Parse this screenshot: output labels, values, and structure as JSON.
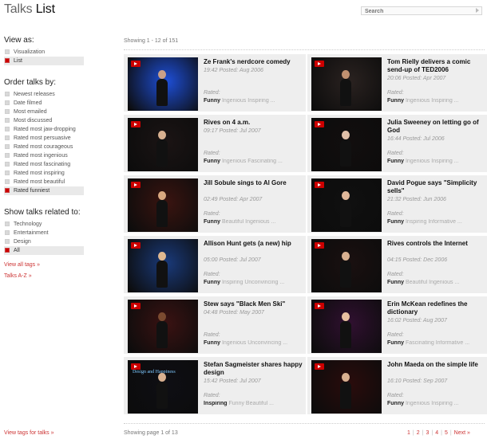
{
  "header": {
    "title_a": "Talks",
    "title_b": "List",
    "search_placeholder": "Search"
  },
  "sidebar": {
    "view_as": {
      "heading": "View as:",
      "items": [
        {
          "label": "Visualization",
          "selected": false
        },
        {
          "label": "List",
          "selected": true
        }
      ]
    },
    "order": {
      "heading": "Order talks by:",
      "items": [
        {
          "label": "Newest releases",
          "selected": false
        },
        {
          "label": "Date filmed",
          "selected": false
        },
        {
          "label": "Most emailed",
          "selected": false
        },
        {
          "label": "Most discussed",
          "selected": false
        },
        {
          "label": "Rated most jaw-dropping",
          "selected": false
        },
        {
          "label": "Rated most persuasive",
          "selected": false
        },
        {
          "label": "Rated most courageous",
          "selected": false
        },
        {
          "label": "Rated most ingenious",
          "selected": false
        },
        {
          "label": "Rated most fascinating",
          "selected": false
        },
        {
          "label": "Rated most inspiring",
          "selected": false
        },
        {
          "label": "Rated most beautiful",
          "selected": false
        },
        {
          "label": "Rated funniest",
          "selected": true
        }
      ]
    },
    "related": {
      "heading": "Show talks related to:",
      "items": [
        {
          "label": "Technology",
          "selected": false
        },
        {
          "label": "Entertainment",
          "selected": false
        },
        {
          "label": "Design",
          "selected": false
        },
        {
          "label": "All",
          "selected": true
        }
      ]
    },
    "view_all_tags": "View all tags »",
    "talks_az": "Talks A-Z »",
    "view_tags_for_talks": "View tags for talks »"
  },
  "main": {
    "showing": "Showing 1 - 12 of 151",
    "talks": [
      {
        "title": "Ze Frank's nerdcore comedy",
        "meta": "19:42 Posted: Aug 2006",
        "rated_label": "Rated:",
        "rating_top": "Funny",
        "rating_rest": "Ingenious Inspiring ...",
        "bg": "#1e4fd8",
        "skin": "#caa088"
      },
      {
        "title": "Tom Rielly delivers a comic send-up of TED2006",
        "meta": "20:06 Posted: Apr 2007",
        "rated_label": "Rated:",
        "rating_top": "Funny",
        "rating_rest": "Ingenious Inspiring ...",
        "bg": "#2a2220",
        "skin": "#c09070"
      },
      {
        "title": "Rives on 4 a.m.",
        "meta": "09:17 Posted: Jul 2007",
        "rated_label": "Rated:",
        "rating_top": "Funny",
        "rating_rest": "Ingenious Fascinating ...",
        "bg": "#1b1414",
        "skin": "#d8b090"
      },
      {
        "title": "Julia Sweeney on letting go of God",
        "meta": "16:44 Posted: Jul 2006",
        "rated_label": "Rated:",
        "rating_top": "Funny",
        "rating_rest": "Ingenious Inspiring ...",
        "bg": "#120e0e",
        "skin": "#e0c0a8"
      },
      {
        "title": "Jill Sobule sings to Al Gore",
        "meta": "02:49 Posted: Apr 2007",
        "rated_label": "Rated:",
        "rating_top": "Funny",
        "rating_rest": "Beautiful Ingenious ...",
        "bg": "#3a1410",
        "skin": "#d8a880"
      },
      {
        "title": "David Pogue says \"Simplicity sells\"",
        "meta": "21:32 Posted: Jun 2006",
        "rated_label": "Rated:",
        "rating_top": "Funny",
        "rating_rest": "Inspiring Informative ...",
        "bg": "#101010",
        "skin": "#e0b89a"
      },
      {
        "title": "Allison Hunt gets (a new) hip",
        "meta": "05:00 Posted: Jul 2007",
        "rated_label": "Rated:",
        "rating_top": "Funny",
        "rating_rest": "Inspiring Unconvincing ...",
        "bg": "#1a3a7a",
        "skin": "#e0b890"
      },
      {
        "title": "Rives controls the Internet",
        "meta": "04:15 Posted: Dec 2006",
        "rated_label": "Rated:",
        "rating_top": "Funny",
        "rating_rest": "Beautiful Ingenious ...",
        "bg": "#1a1010",
        "skin": "#d8b090"
      },
      {
        "title": "Stew says \"Black Men Ski\"",
        "meta": "04:48 Posted: May 2007",
        "rated_label": "Rated:",
        "rating_top": "Funny",
        "rating_rest": "Ingenious Unconvincing ...",
        "bg": "#3a1212",
        "skin": "#7a4a30"
      },
      {
        "title": "Erin McKean redefines the dictionary",
        "meta": "16:02 Posted: Aug 2007",
        "rated_label": "Rated:",
        "rating_top": "Funny",
        "rating_rest": "Fascinating Informative ...",
        "bg": "#301030",
        "skin": "#e8c0a0"
      },
      {
        "title": "Stefan Sagmeister shares happy design",
        "meta": "15:42 Posted: Jul 2007",
        "rated_label": "Rated:",
        "rating_top": "Inspiring",
        "rating_rest": "Funny Beautiful ...",
        "bg": "#0e0e14",
        "skin": "#d8b090",
        "caption": "Design and Happiness"
      },
      {
        "title": "John Maeda on the simple life",
        "meta": "16:10 Posted: Sep 2007",
        "rated_label": "Rated:",
        "rating_top": "Funny",
        "rating_rest": "Ingenious Inspiring ...",
        "bg": "#2a0c0c",
        "skin": "#d8b090"
      }
    ]
  },
  "footer": {
    "page_info": "Showing page 1 of 13",
    "pages": [
      "1",
      "2",
      "3",
      "4",
      "5"
    ],
    "next": "Next »"
  }
}
